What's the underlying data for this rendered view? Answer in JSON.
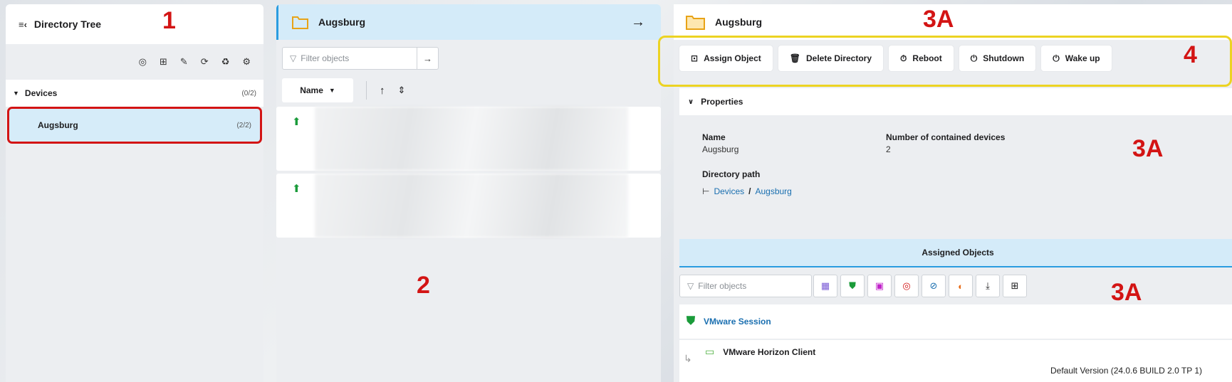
{
  "panel1": {
    "title": "Directory Tree",
    "toolbar_icons": [
      "target-icon",
      "new-folder-icon",
      "edit-icon",
      "refresh-icon",
      "recycle-icon",
      "settings-icon"
    ],
    "tree": [
      {
        "label": "Devices",
        "count": "(0/2)"
      },
      {
        "label": "Augsburg",
        "count": "(2/2)"
      }
    ],
    "marker": "1"
  },
  "panel2": {
    "title": "Augsburg",
    "filter_placeholder": "Filter objects",
    "sort_label": "Name",
    "marker": "2"
  },
  "panel3": {
    "title": "Augsburg",
    "marker_top": "3A",
    "actions": [
      "Assign Object",
      "Delete Directory",
      "Reboot",
      "Shutdown",
      "Wake up"
    ],
    "actions_marker": "4",
    "properties_label": "Properties",
    "name_label": "Name",
    "name_value": "Augsburg",
    "contained_label": "Number of contained devices",
    "contained_value": "2",
    "path_label": "Directory path",
    "path_root": "Devices",
    "path_sep": "/",
    "path_leaf": "Augsburg",
    "marker_mid": "3A",
    "assigned_label": "Assigned Objects",
    "assigned_filter_placeholder": "Filter objects",
    "marker_bottom": "3A",
    "session_name": "VMware Session",
    "client_name": "VMware Horizon Client",
    "client_version": "Default Version (24.0.6 BUILD 2.0 TP 1)"
  },
  "colors": {
    "accent": "#2a9ce0",
    "highlight_red": "#d31414",
    "highlight_yellow": "#ecd322"
  }
}
